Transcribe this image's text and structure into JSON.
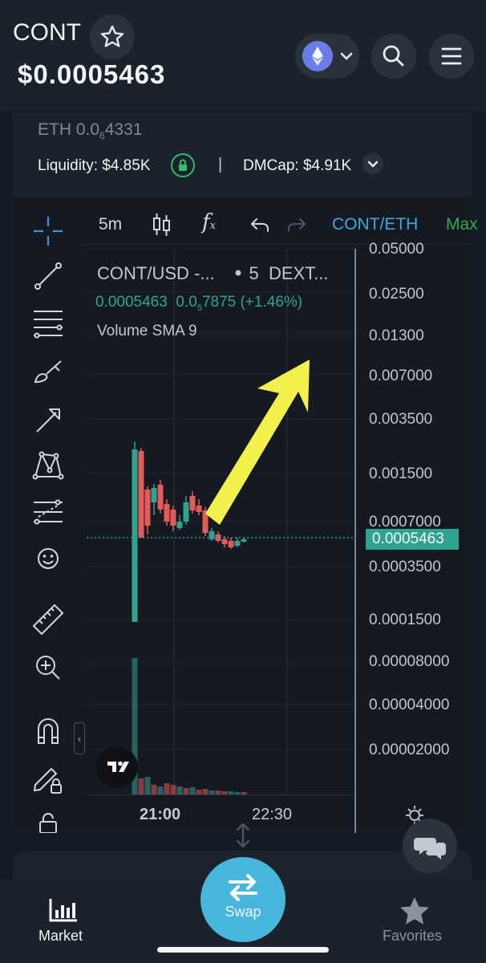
{
  "header": {
    "token_symbol": "CONT",
    "price": "$0.0005463"
  },
  "info": {
    "eth_price_prefix": "ETH 0.0",
    "eth_price_sub": "6",
    "eth_price_suffix": "4331",
    "liquidity": "Liquidity: $4.85K",
    "separator": "|",
    "dmcap": "DMCap: $4.91K"
  },
  "chart": {
    "timeframe": "5m",
    "function_icon_label": "f",
    "pair_tab": "CONT/ETH",
    "max_tab": "Max",
    "legend_title": "CONT/USD -...",
    "legend_interval": "5",
    "legend_source": "DEXT...",
    "legend_price": "0.0005463",
    "legend_change_prefix": "0.0",
    "legend_change_sub": "5",
    "legend_change_suffix": "7875 (+1.46%)",
    "volume_label": "Volume SMA 9",
    "price_axis_labels": [
      "0.05000",
      "0.02500",
      "0.01300",
      "0.007000",
      "0.003500",
      "0.001500",
      "0.0007000",
      "0.0003500",
      "0.0001500",
      "0.00008000",
      "0.00004000",
      "0.00002000"
    ],
    "last_price_tag": "0.0005463",
    "time_labels": [
      "21:00",
      "22:30"
    ],
    "colors": {
      "up": "#2fa38f",
      "down": "#e45a5a",
      "annotation_arrow": "#f2f04a"
    }
  },
  "nav": {
    "market": "Market",
    "swap": "Swap",
    "favorites": "Favorites"
  }
}
